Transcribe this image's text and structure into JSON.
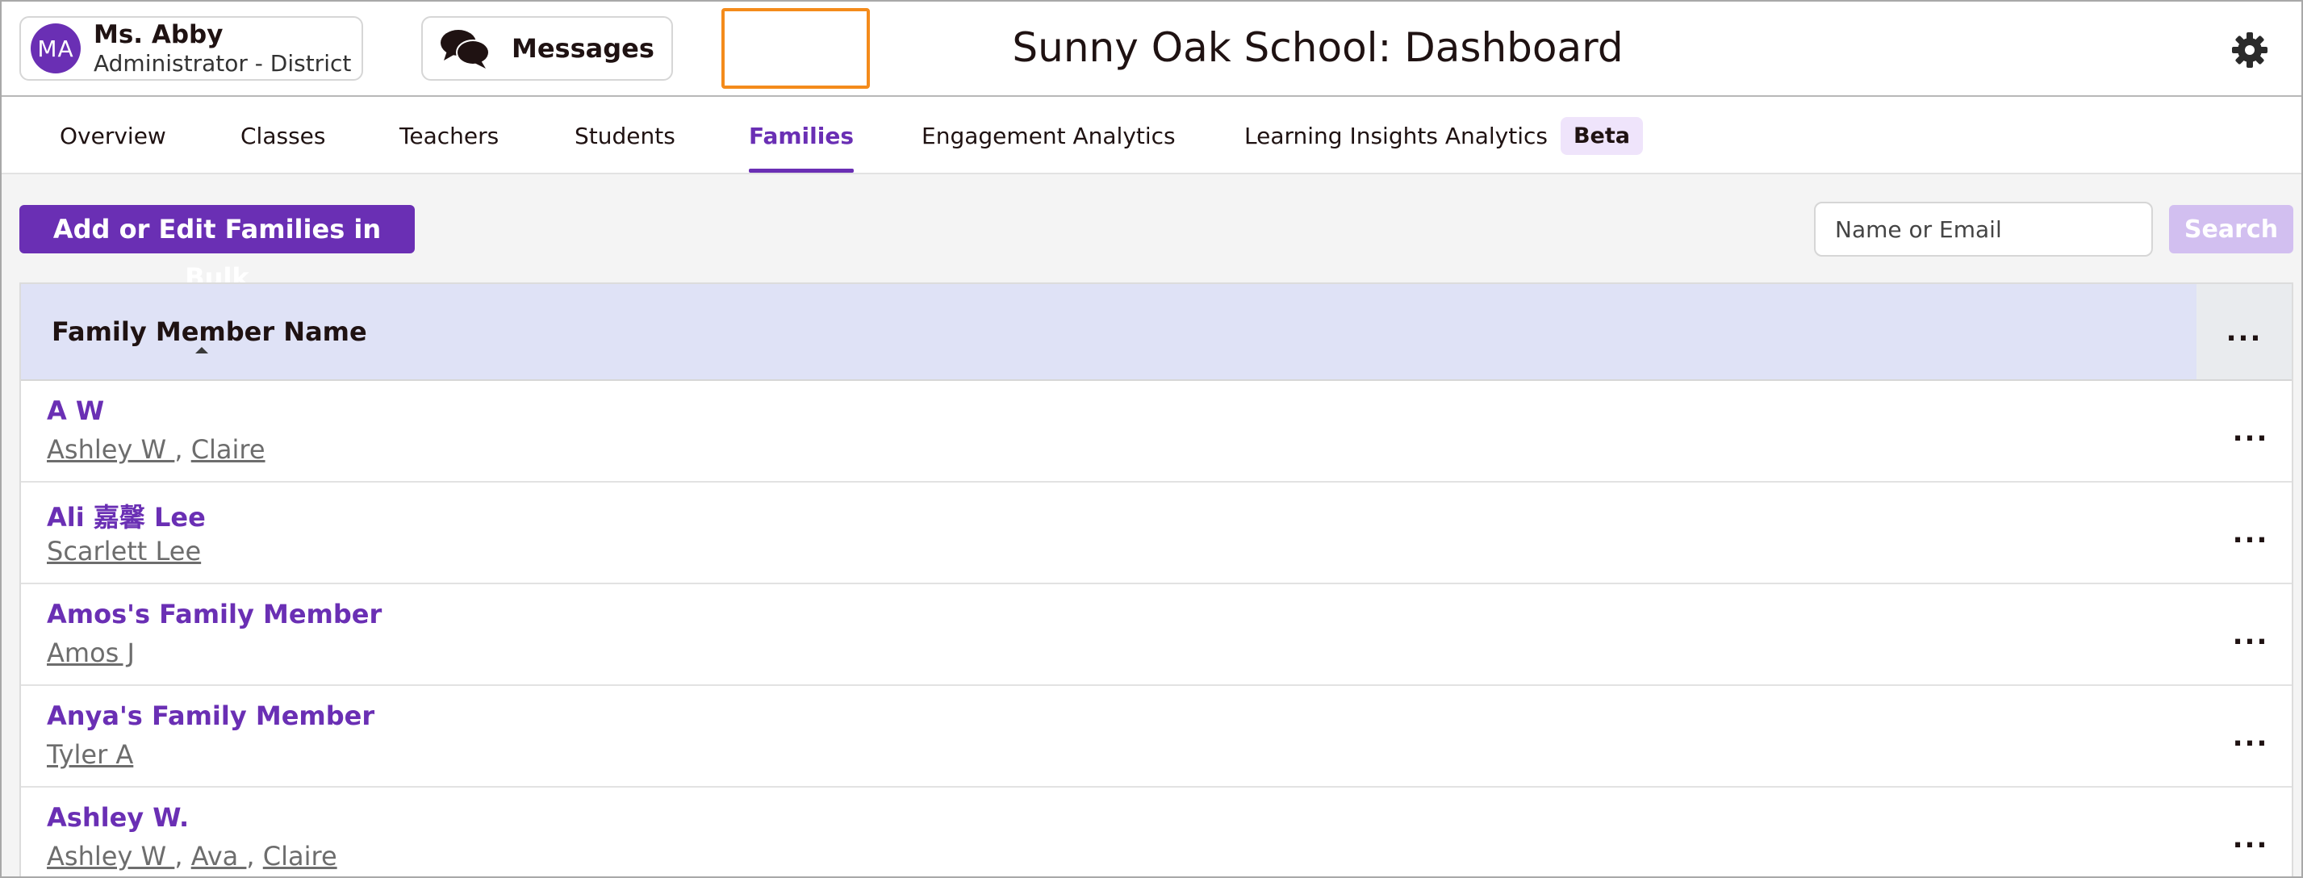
{
  "header": {
    "user": {
      "initials": "MA",
      "name": "Ms. Abby",
      "role": "Administrator - District"
    },
    "messages_label": "Messages",
    "title": "Sunny Oak School: Dashboard"
  },
  "tabs": [
    {
      "label": "Overview"
    },
    {
      "label": "Classes"
    },
    {
      "label": "Teachers"
    },
    {
      "label": "Students"
    },
    {
      "label": "Families",
      "active": true
    },
    {
      "label": "Engagement Analytics"
    },
    {
      "label": "Learning Insights Analytics",
      "badge": "Beta"
    }
  ],
  "toolbar": {
    "bulk_label": "Add or Edit Families in Bulk",
    "search_placeholder": "Name or Email",
    "search_label": "Search"
  },
  "table": {
    "column_header": "Family Member Name",
    "menu_label": "...",
    "rows": [
      {
        "name": "A W",
        "students": [
          "Ashley W ",
          "Claire"
        ]
      },
      {
        "name": "Ali 嘉馨 Lee",
        "students": [
          "Scarlett Lee"
        ]
      },
      {
        "name": "Amos's Family Member",
        "students": [
          "Amos J"
        ]
      },
      {
        "name": "Anya's Family Member",
        "students": [
          "Tyler A"
        ]
      },
      {
        "name": "Ashley W.",
        "students": [
          "Ashley W ",
          "Ava ",
          "Claire"
        ]
      }
    ]
  },
  "colors": {
    "accent": "#6a2fb4",
    "highlight": "#f48b1b",
    "table_header": "#dfe2f6"
  },
  "icons": {
    "messages": "chat-bubbles-icon",
    "settings": "gear-icon"
  }
}
